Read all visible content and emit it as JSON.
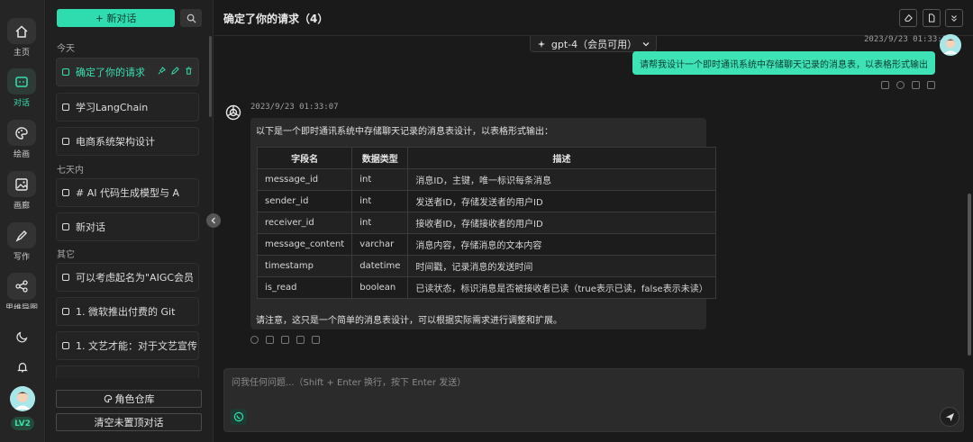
{
  "rail": {
    "items": [
      {
        "label": "主页",
        "icon": "home-icon"
      },
      {
        "label": "对话",
        "icon": "chat-icon",
        "active": true
      },
      {
        "label": "绘画",
        "icon": "palette-icon"
      },
      {
        "label": "画廊",
        "icon": "gallery-icon"
      },
      {
        "label": "写作",
        "icon": "pen-icon"
      },
      {
        "label": "思维导图",
        "icon": "mindmap-icon"
      }
    ],
    "level": "LV2"
  },
  "sidebar": {
    "new_chat_label": "+ 新对话",
    "sections": {
      "today": "今天",
      "week": "七天内",
      "other": "其它"
    },
    "conversations": [
      {
        "title": "确定了你的请求"
      },
      {
        "title": "学习LangChain"
      },
      {
        "title": "电商系统架构设计"
      },
      {
        "title": "# AI 代码生成模型与 A"
      },
      {
        "title": "新对话"
      },
      {
        "title": "可以考虑起名为\"AIGC会员"
      },
      {
        "title": "1. 微软推出付费的 Git"
      },
      {
        "title": "1. 文艺才能：对于文艺宣传"
      }
    ],
    "role_warehouse": "角色仓库",
    "clear_label": "清空未置顶对话"
  },
  "header": {
    "title": "确定了你的请求（4）"
  },
  "model": {
    "label": "gpt-4（会员可用）"
  },
  "messages": {
    "user": {
      "time": "2023/9/23 01:33:07",
      "text": "请帮我设计一个即时通讯系统中存储聊天记录的消息表，以表格形式输出"
    },
    "bot": {
      "time": "2023/9/23 01:33:07",
      "intro": "以下是一个即时通讯系统中存储聊天记录的消息表设计，以表格形式输出：",
      "note": "请注意，这只是一个简单的消息表设计，可以根据实际需求进行调整和扩展。",
      "table": {
        "headers": [
          "字段名",
          "数据类型",
          "描述"
        ],
        "rows": [
          [
            "message_id",
            "int",
            "消息ID，主键，唯一标识每条消息"
          ],
          [
            "sender_id",
            "int",
            "发送者ID，存储发送者的用户ID"
          ],
          [
            "receiver_id",
            "int",
            "接收者ID，存储接收者的用户ID"
          ],
          [
            "message_content",
            "varchar",
            "消息内容，存储消息的文本内容"
          ],
          [
            "timestamp",
            "datetime",
            "时间戳，记录消息的发送时间"
          ],
          [
            "is_read",
            "boolean",
            "已读状态，标识消息是否被接收者已读（true表示已读，false表示未读）"
          ]
        ]
      }
    }
  },
  "input": {
    "placeholder": "问我任何问题...（Shift + Enter 换行，按下 Enter 发送）"
  },
  "colors": {
    "accent": "#38e0b0",
    "background": "#1a1a1a",
    "panel": "#2a2a2a"
  }
}
